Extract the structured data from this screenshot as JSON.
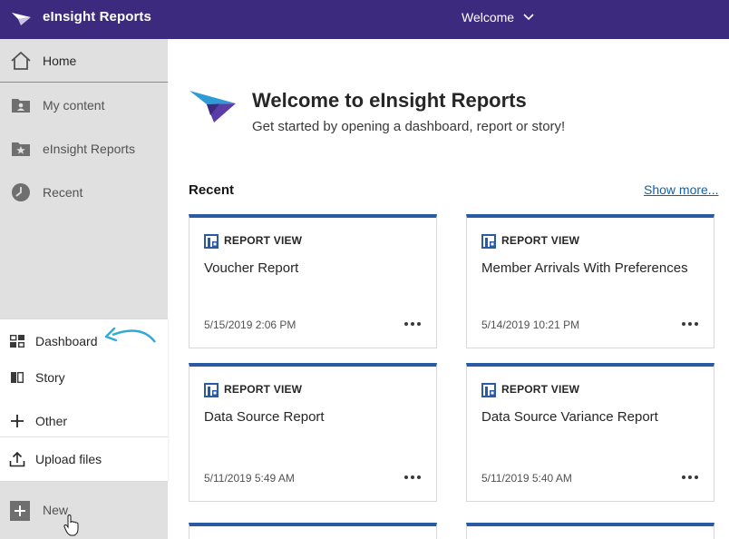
{
  "header": {
    "app_title": "eInsight Reports",
    "welcome_label": "Welcome"
  },
  "sidebar": {
    "items": [
      {
        "label": "Home",
        "icon": "home-icon"
      },
      {
        "label": "My content",
        "icon": "user-folder-icon"
      },
      {
        "label": "eInsight Reports",
        "icon": "star-folder-icon"
      },
      {
        "label": "Recent",
        "icon": "clock-icon"
      }
    ],
    "new_menu": [
      {
        "label": "Dashboard",
        "icon": "dashboard-icon"
      },
      {
        "label": "Story",
        "icon": "book-icon"
      },
      {
        "label": "Other",
        "icon": "plus-icon"
      },
      {
        "label": "Upload files",
        "icon": "upload-icon"
      }
    ],
    "new_label": "New"
  },
  "main": {
    "title": "Welcome to eInsight Reports",
    "subtitle": "Get started by opening a dashboard, report or story!",
    "recent_title": "Recent",
    "show_more": "Show more...",
    "cards": [
      {
        "type": "REPORT VIEW",
        "name": "Voucher Report",
        "date": "5/15/2019 2:06 PM"
      },
      {
        "type": "REPORT VIEW",
        "name": "Member Arrivals With Preferences",
        "date": "5/14/2019 10:21 PM"
      },
      {
        "type": "REPORT VIEW",
        "name": "Data Source Report",
        "date": "5/11/2019 5:49 AM"
      },
      {
        "type": "REPORT VIEW",
        "name": "Data Source Variance Report",
        "date": "5/11/2019 5:40 AM"
      }
    ]
  },
  "colors": {
    "header_bg": "#3b2a7e",
    "card_accent": "#2a5aa3",
    "link": "#0f62a8",
    "annotation_arrow": "#33a8d8"
  }
}
